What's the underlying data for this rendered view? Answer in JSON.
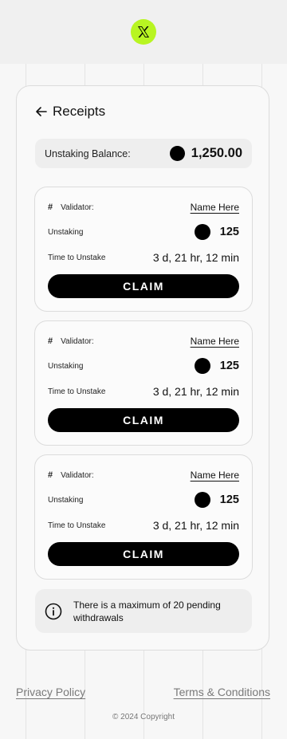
{
  "brand": {
    "logo_icon": "x-logo-icon",
    "accent": "#b8f522"
  },
  "header": {
    "back_icon": "arrow-left-icon",
    "title": "Receipts"
  },
  "balance": {
    "label": "Unstaking Balance:",
    "value": "1,250.00"
  },
  "receipts": [
    {
      "hash": "#",
      "validator_label": "Validator:",
      "validator_name": "Name Here",
      "unstaking_label": "Unstaking",
      "unstaking_amount": "125",
      "time_label": "Time to Unstake",
      "time_value": "3 d, 21 hr, 12 min",
      "claim_label": "CLAIM"
    },
    {
      "hash": "#",
      "validator_label": "Validator:",
      "validator_name": "Name Here",
      "unstaking_label": "Unstaking",
      "unstaking_amount": "125",
      "time_label": "Time to Unstake",
      "time_value": "3 d, 21 hr, 12 min",
      "claim_label": "CLAIM"
    },
    {
      "hash": "#",
      "validator_label": "Validator:",
      "validator_name": "Name Here",
      "unstaking_label": "Unstaking",
      "unstaking_amount": "125",
      "time_label": "Time to Unstake",
      "time_value": "3 d, 21 hr, 12 min",
      "claim_label": "CLAIM"
    }
  ],
  "info": {
    "icon": "info-icon",
    "text": "There is a maximum of 20 pending withdrawals"
  },
  "footer": {
    "privacy": "Privacy Policy",
    "terms": "Terms & Conditions",
    "copyright": "© 2024 Copyright"
  }
}
